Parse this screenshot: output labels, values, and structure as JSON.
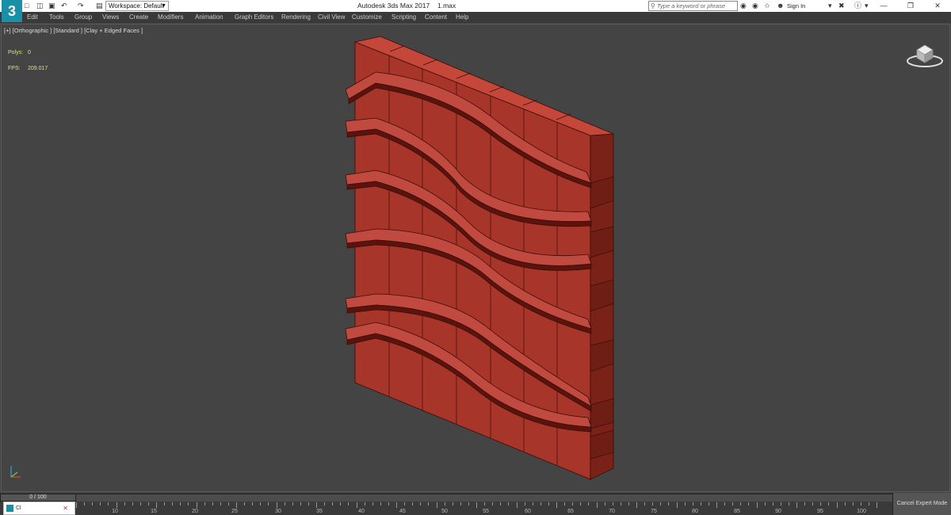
{
  "window": {
    "title": "Autodesk 3ds Max 2017",
    "file": "1.max",
    "logo": "3"
  },
  "quick_access": {
    "icons": [
      "new-file-icon",
      "open-file-icon",
      "save-icon",
      "undo-icon",
      "redo-icon",
      "project-folder-icon"
    ],
    "workspace_label": "Workspace: Default"
  },
  "search": {
    "placeholder": "Type a keyword or phrase"
  },
  "account": {
    "sign_in": "Sign In"
  },
  "menu": [
    "Edit",
    "Tools",
    "Group",
    "Views",
    "Create",
    "Modifiers",
    "Animation",
    "Graph Editors",
    "Rendering",
    "Civil View",
    "Customize",
    "Scripting",
    "Content",
    "Help"
  ],
  "viewport": {
    "label": "[+] [Orthographic ] [Standard ] [Clay + Edged Faces ]",
    "polys_label": "Polys:",
    "polys_value": "0",
    "fps_label": "FPS:",
    "fps_value": "209.017"
  },
  "timeline": {
    "slider": "0 / 100",
    "ticks": [
      "10",
      "15",
      "20",
      "25",
      "30",
      "35",
      "40",
      "45",
      "50",
      "55",
      "60",
      "65",
      "70",
      "75",
      "80",
      "85",
      "90",
      "95",
      "100"
    ],
    "cancel_expert": "Cancel Expert Mode"
  },
  "colors": {
    "model_face": "#a8352a",
    "model_side": "#7a2218",
    "model_top": "#c4473a",
    "viewport_bg": "#444444",
    "stat_text": "#e8e06a"
  },
  "taskbar": {
    "label": "Cl"
  }
}
